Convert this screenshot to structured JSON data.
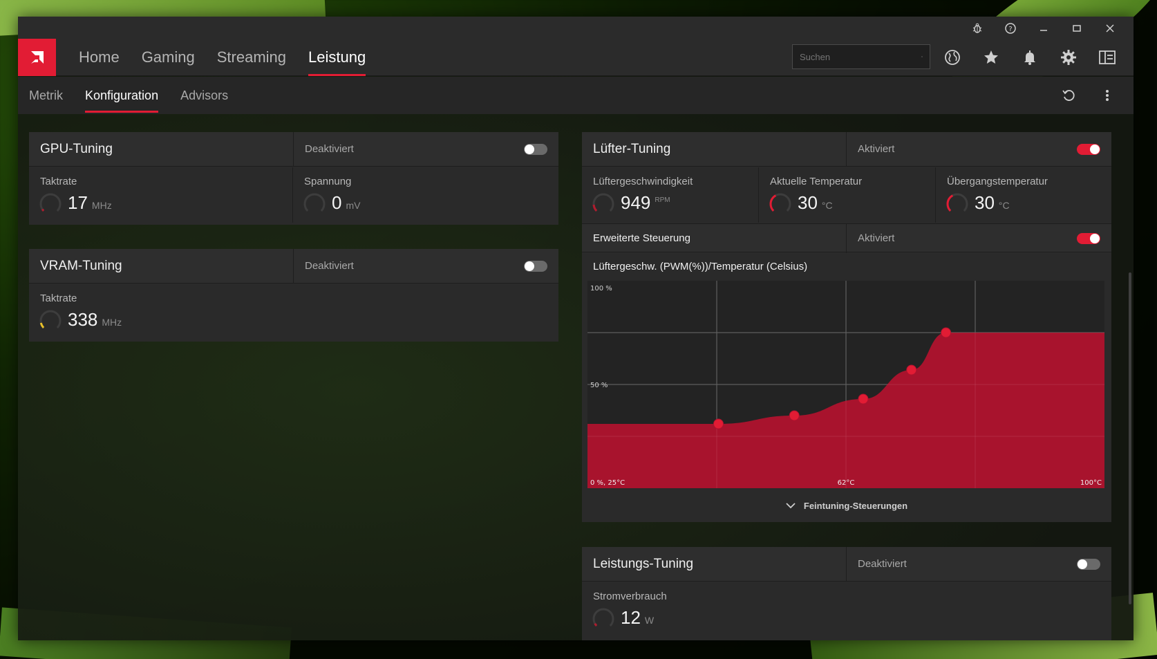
{
  "colors": {
    "accent": "#e21c34",
    "gauge_yellow": "#e8c02a"
  },
  "titlebar": {
    "icons": [
      "bug-icon",
      "help-icon",
      "minimize-icon",
      "maximize-icon",
      "close-icon"
    ]
  },
  "nav": {
    "tabs": [
      {
        "label": "Home"
      },
      {
        "label": "Gaming"
      },
      {
        "label": "Streaming"
      },
      {
        "label": "Leistung",
        "active": true
      }
    ],
    "search_placeholder": "Suchen",
    "icons": [
      "globe-icon",
      "star-icon",
      "bell-icon",
      "gear-icon",
      "sidebar-icon"
    ]
  },
  "subnav": {
    "tabs": [
      {
        "label": "Metrik"
      },
      {
        "label": "Konfiguration",
        "active": true
      },
      {
        "label": "Advisors"
      }
    ],
    "icons": [
      "reset-icon",
      "more-icon"
    ]
  },
  "gpu_tuning": {
    "title": "GPU-Tuning",
    "status": "Deaktiviert",
    "enabled": false,
    "metrics": [
      {
        "label": "Taktrate",
        "value": "17",
        "unit": "MHz"
      },
      {
        "label": "Spannung",
        "value": "0",
        "unit": "mV"
      }
    ]
  },
  "vram_tuning": {
    "title": "VRAM-Tuning",
    "status": "Deaktiviert",
    "enabled": false,
    "metrics": [
      {
        "label": "Taktrate",
        "value": "338",
        "unit": "MHz"
      }
    ]
  },
  "fan_tuning": {
    "title": "Lüfter-Tuning",
    "status": "Aktiviert",
    "enabled": true,
    "metrics": [
      {
        "label": "Lüftergeschwindigkeit",
        "value": "949",
        "unit": "RPM"
      },
      {
        "label": "Aktuelle Temperatur",
        "value": "30",
        "unit": "°C"
      },
      {
        "label": "Übergangstemperatur",
        "value": "30",
        "unit": "°C"
      }
    ],
    "advanced": {
      "label": "Erweiterte Steuerung",
      "status": "Aktiviert",
      "enabled": true
    },
    "curve_title": "Lüftergeschw. (PWM(%))/Temperatur (Celsius)",
    "finetune_label": "Feintuning-Steuerungen"
  },
  "chart_data": {
    "type": "area",
    "title": "Lüftergeschw. (PWM(%))/Temperatur (Celsius)",
    "x_labels": {
      "min": "0 %, 25°C",
      "mid": "62°C",
      "max": "100°C"
    },
    "y_labels": {
      "max": "100 %",
      "mid": "50 %"
    },
    "xlim": [
      25,
      100
    ],
    "ylim": [
      0,
      100
    ],
    "points": [
      {
        "x": 44,
        "y": 31
      },
      {
        "x": 55,
        "y": 35
      },
      {
        "x": 65,
        "y": 43
      },
      {
        "x": 72,
        "y": 57
      },
      {
        "x": 77,
        "y": 75
      }
    ],
    "start": {
      "x": 25,
      "y": 31
    },
    "end": {
      "x": 100,
      "y": 75
    }
  },
  "power_tuning": {
    "title": "Leistungs-Tuning",
    "status": "Deaktiviert",
    "enabled": false,
    "metrics": [
      {
        "label": "Stromverbrauch",
        "value": "12",
        "unit": "W"
      }
    ]
  }
}
